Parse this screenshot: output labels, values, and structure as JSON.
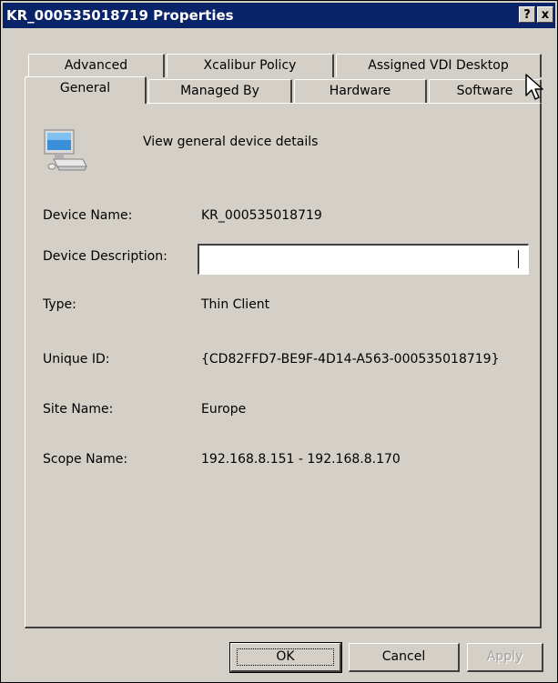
{
  "window": {
    "title": "KR_000535018719 Properties",
    "help_button": "?",
    "close_button": "x"
  },
  "tabs": {
    "row_back": [
      "Advanced",
      "Xcalibur Policy",
      "Assigned VDI Desktop"
    ],
    "row_front": [
      "General",
      "Managed By",
      "Hardware",
      "Software"
    ],
    "active": "General"
  },
  "general": {
    "header_icon": "computer-icon",
    "header_text": "View general device details",
    "fields": {
      "device_name": {
        "label": "Device Name:",
        "value": "KR_000535018719"
      },
      "device_description": {
        "label": "Device Description:",
        "value": ""
      },
      "type": {
        "label": "Type:",
        "value": "Thin Client"
      },
      "unique_id": {
        "label": "Unique ID:",
        "value": "{CD82FFD7-BE9F-4D14-A563-000535018719}"
      },
      "site_name": {
        "label": "Site Name:",
        "value": "Europe"
      },
      "scope_name": {
        "label": "Scope Name:",
        "value": "192.168.8.151 - 192.168.8.170"
      }
    }
  },
  "buttons": {
    "ok": "OK",
    "cancel": "Cancel",
    "apply": "Apply"
  }
}
